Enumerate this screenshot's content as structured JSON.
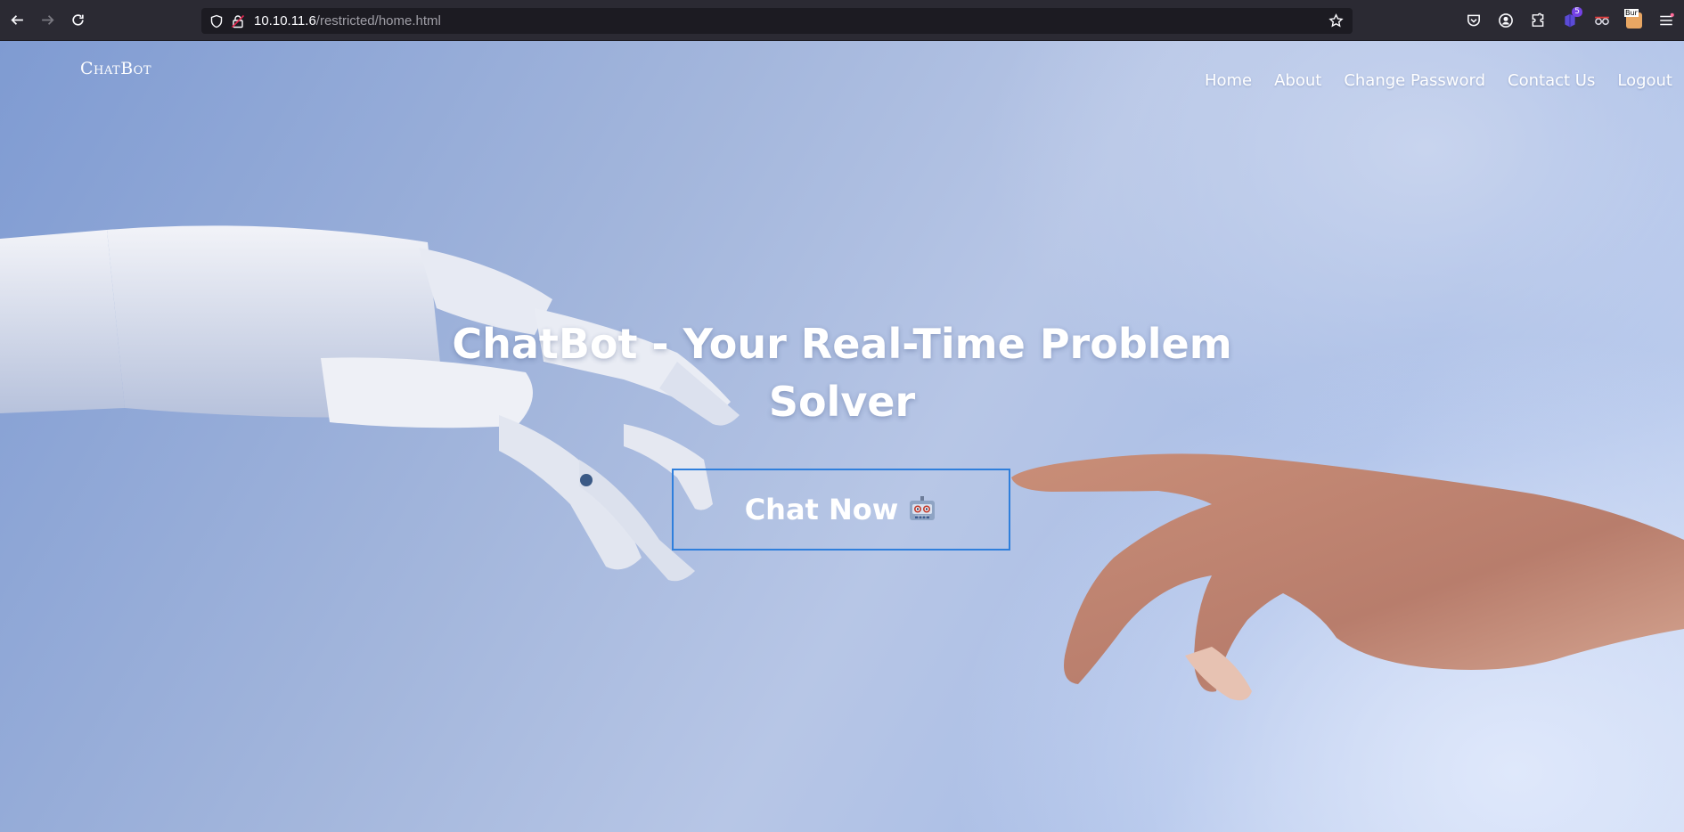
{
  "browser": {
    "url_host": "10.10.11.6",
    "url_path": "/restricted/home.html",
    "extension_badge": "5",
    "burp_label": "Bur"
  },
  "site": {
    "brand": "ChatBot",
    "nav": [
      "Home",
      "About",
      "Change Password",
      "Contact Us",
      "Logout"
    ],
    "headline_line1": "ChatBot - Your Real-Time Problem",
    "headline_line2": "Solver",
    "cta_label": "Chat Now"
  },
  "colors": {
    "cta_border": "#2f7fdc",
    "chrome_bg": "#2b2a33",
    "url_bg": "#1c1b22"
  },
  "icons": {
    "cta": "robot-icon",
    "toolbar": [
      "pocket-icon",
      "account-icon",
      "extensions-icon",
      "extension-icon",
      "glasses-extension-icon",
      "burp-extension-icon",
      "menu-icon"
    ]
  }
}
